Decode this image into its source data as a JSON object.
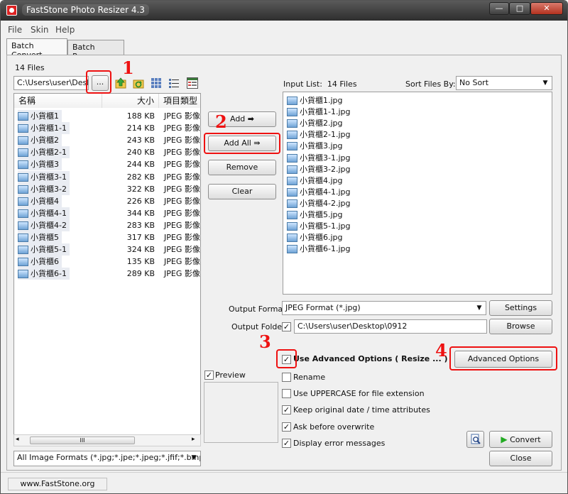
{
  "window": {
    "title": "FastStone Photo Resizer 4.3",
    "min_glyph": "—",
    "max_glyph": "□",
    "close_glyph": "✕"
  },
  "menu": [
    "File",
    "Skin",
    "Help"
  ],
  "tabs": [
    "Batch Convert",
    "Batch Rename"
  ],
  "left": {
    "file_count": "14 Files",
    "path": "C:\\Users\\user\\Deskt",
    "browse_label": "...",
    "columns": [
      "名稱",
      "大小",
      "項目類型"
    ],
    "files": [
      {
        "name": "小貨櫃1",
        "size": "188 KB",
        "type": "JPEG 影像"
      },
      {
        "name": "小貨櫃1-1",
        "size": "214 KB",
        "type": "JPEG 影像"
      },
      {
        "name": "小貨櫃2",
        "size": "243 KB",
        "type": "JPEG 影像"
      },
      {
        "name": "小貨櫃2-1",
        "size": "240 KB",
        "type": "JPEG 影像"
      },
      {
        "name": "小貨櫃3",
        "size": "244 KB",
        "type": "JPEG 影像"
      },
      {
        "name": "小貨櫃3-1",
        "size": "282 KB",
        "type": "JPEG 影像"
      },
      {
        "name": "小貨櫃3-2",
        "size": "322 KB",
        "type": "JPEG 影像"
      },
      {
        "name": "小貨櫃4",
        "size": "226 KB",
        "type": "JPEG 影像"
      },
      {
        "name": "小貨櫃4-1",
        "size": "344 KB",
        "type": "JPEG 影像"
      },
      {
        "name": "小貨櫃4-2",
        "size": "283 KB",
        "type": "JPEG 影像"
      },
      {
        "name": "小貨櫃5",
        "size": "317 KB",
        "type": "JPEG 影像"
      },
      {
        "name": "小貨櫃5-1",
        "size": "324 KB",
        "type": "JPEG 影像"
      },
      {
        "name": "小貨櫃6",
        "size": "135 KB",
        "type": "JPEG 影像"
      },
      {
        "name": "小貨櫃6-1",
        "size": "289 KB",
        "type": "JPEG 影像"
      }
    ],
    "scroll_grip": "III",
    "format_filter": "All Image Formats (*.jpg;*.jpe;*.jpeg;*.jfif;*.bmp"
  },
  "middle": {
    "add": "Add",
    "add_all": "Add All",
    "remove": "Remove",
    "clear": "Clear",
    "preview": "Preview"
  },
  "input_list": {
    "label": "Input List:",
    "count": "14 Files",
    "sort_label": "Sort Files By:",
    "sort_value": "No Sort",
    "files": [
      "小貨櫃1.jpg",
      "小貨櫃1-1.jpg",
      "小貨櫃2.jpg",
      "小貨櫃2-1.jpg",
      "小貨櫃3.jpg",
      "小貨櫃3-1.jpg",
      "小貨櫃3-2.jpg",
      "小貨櫃4.jpg",
      "小貨櫃4-1.jpg",
      "小貨櫃4-2.jpg",
      "小貨櫃5.jpg",
      "小貨櫃5-1.jpg",
      "小貨櫃6.jpg",
      "小貨櫃6-1.jpg"
    ]
  },
  "output": {
    "format_label": "Output Format:",
    "format_value": "JPEG Format (*.jpg)",
    "settings": "Settings",
    "folder_label": "Output Folder:",
    "folder_value": "C:\\Users\\user\\Desktop\\0912",
    "browse": "Browse"
  },
  "options": {
    "advanced_label": "Use Advanced Options ( Resize ... )",
    "advanced_button": "Advanced Options",
    "rename": "Rename",
    "uppercase": "Use UPPERCASE for file extension",
    "keep_date": "Keep original date / time attributes",
    "ask_overwrite": "Ask before overwrite",
    "display_errors": "Display error messages"
  },
  "actions": {
    "convert": "Convert",
    "close": "Close"
  },
  "status": {
    "website": "www.FastStone.org"
  },
  "annotations": {
    "n1": "1",
    "n2": "2",
    "n3": "3",
    "n4": "4"
  },
  "icons": {
    "folder_up": "folder-up-icon",
    "refresh": "folder-refresh-icon",
    "view_thumbs": "view-thumbnails-icon",
    "view_list": "view-list-icon",
    "view_details": "view-details-icon",
    "preview_magnifier": "magnifier-icon",
    "convert_arrow": "green-arrow-icon"
  },
  "colors": {
    "annotation_red": "#e11111",
    "convert_green": "#22aa22"
  }
}
